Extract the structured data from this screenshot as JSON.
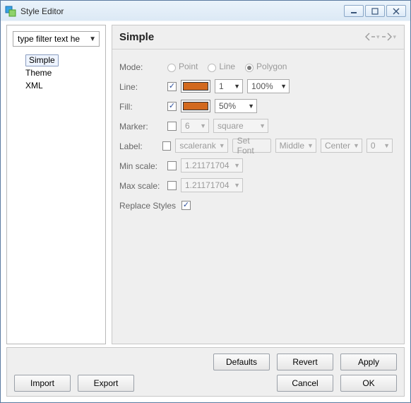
{
  "window": {
    "title": "Style Editor"
  },
  "sidebar": {
    "filter_placeholder": "type filter text he",
    "items": [
      {
        "label": "Simple",
        "selected": true
      },
      {
        "label": "Theme",
        "selected": false
      },
      {
        "label": "XML",
        "selected": false
      }
    ]
  },
  "panel": {
    "title": "Simple",
    "mode": {
      "label": "Mode:",
      "options": [
        {
          "label": "Point",
          "selected": false
        },
        {
          "label": "Line",
          "selected": false
        },
        {
          "label": "Polygon",
          "selected": true
        }
      ]
    },
    "line": {
      "label": "Line:",
      "enabled": true,
      "color": "#D2691E",
      "width": "1",
      "opacity": "100%"
    },
    "fill": {
      "label": "Fill:",
      "enabled": true,
      "color": "#D2691E",
      "opacity": "50%"
    },
    "marker": {
      "label": "Marker:",
      "enabled": false,
      "size": "6",
      "shape": "square"
    },
    "labelRow": {
      "label": "Label:",
      "enabled": false,
      "attribute": "scalerank",
      "setFontButton": "Set Font",
      "vAlign": "Middle",
      "hAlign": "Center",
      "offset": "0"
    },
    "minScale": {
      "label": "Min scale:",
      "enabled": false,
      "value": "1.21171704"
    },
    "maxScale": {
      "label": "Max scale:",
      "enabled": false,
      "value": "1.21171704"
    },
    "replace": {
      "label": "Replace Styles",
      "enabled": true
    }
  },
  "buttons": {
    "defaults": "Defaults",
    "revert": "Revert",
    "apply": "Apply",
    "import": "Import",
    "export": "Export",
    "cancel": "Cancel",
    "ok": "OK"
  }
}
